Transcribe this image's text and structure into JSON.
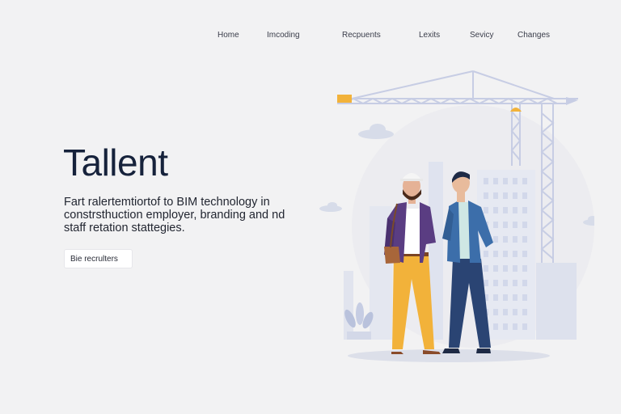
{
  "nav": {
    "items": [
      "Home",
      "Imcoding",
      "Recpuents",
      "Lexits",
      "Sevicy",
      "Changes"
    ]
  },
  "hero": {
    "title": "Tallent",
    "description": "Fart ralertemtiortof to BIM technology in constrsthuction employer, branding and nd staff retation stattegies.",
    "cta_label": "Bie recrulters"
  },
  "illustration": {
    "subject": "two people talking at a construction site with crane and buildings"
  },
  "colors": {
    "background": "#f2f2f3",
    "title": "#16223b",
    "crane": "#c7cde4",
    "accent": "#f2b23a",
    "jacket_purple": "#5a3d82",
    "jacket_blue": "#3c6eaa"
  }
}
